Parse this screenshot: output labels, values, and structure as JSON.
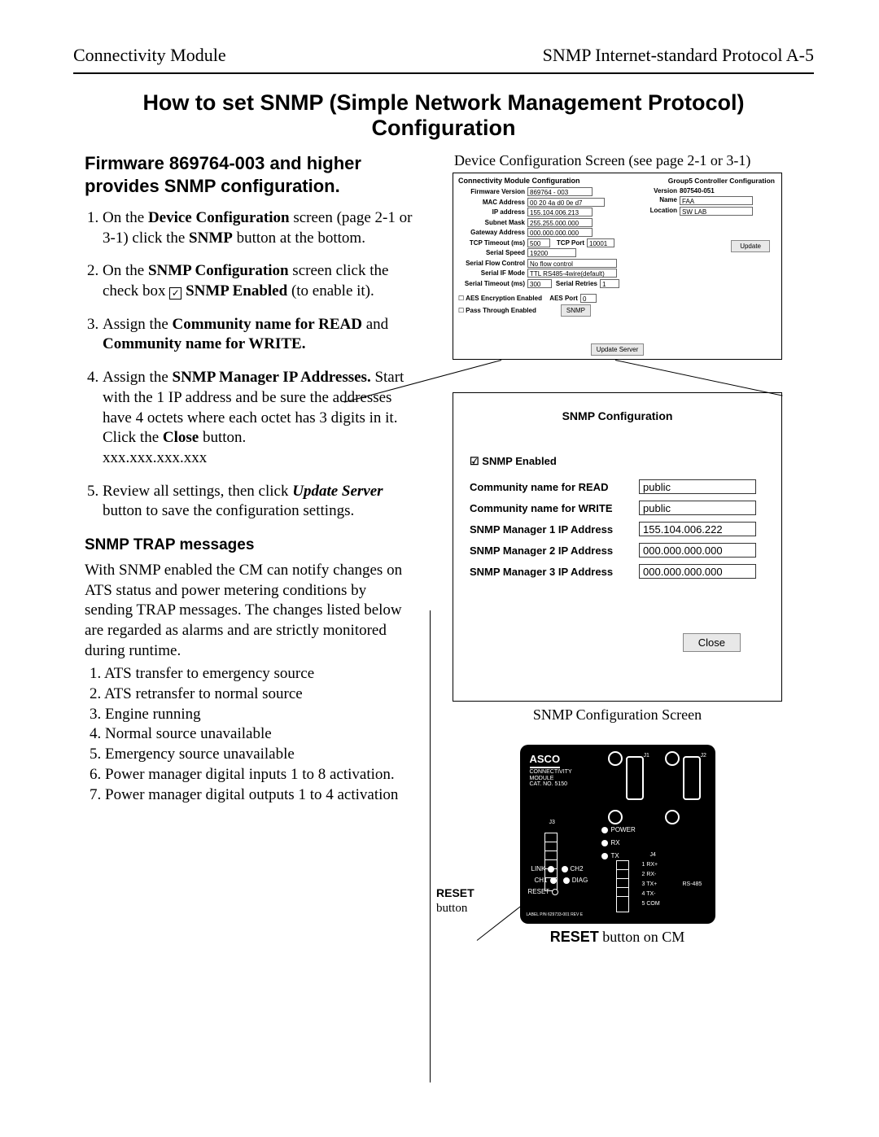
{
  "header": {
    "left": "Connectivity Module",
    "right": "SNMP Internet-standard Protocol    A-5"
  },
  "title": "How to set SNMP (Simple Network Management Protocol) Configuration",
  "subhead": "Firmware 869764-003 and higher provides SNMP configuration.",
  "steps": {
    "s1a": "On the ",
    "s1b": "Device Configuration",
    "s1c": " screen (page 2-1 or 3-1) click the ",
    "s1d": "SNMP",
    "s1e": " button at the bottom.",
    "s2a": "On the ",
    "s2b": "SNMP Configuration",
    "s2c": " screen click the check box  ",
    "s2chk": "☑",
    "s2d": " SNMP Enabled",
    "s2e": " (to enable it).",
    "s3a": "Assign the ",
    "s3b": "Community name for READ",
    "s3c": " and ",
    "s3d": "Community name for WRITE.",
    "s4a": "Assign the ",
    "s4b": "SNMP Manager IP Addresses.",
    "s4c": " Start with the 1 IP address and be sure the addresses have 4 octets where each octet has 3 digits in it.  Click the ",
    "s4d": "Close",
    "s4e": " button.",
    "s4f": "xxx.xxx.xxx.xxx",
    "s5a": "Review all settings, then click ",
    "s5b": "Update Server",
    "s5c": " button to save the configuration settings."
  },
  "trap_head": "SNMP TRAP messages",
  "trap_para": "With SNMP enabled the CM can notify changes on ATS status and power metering conditions by sending TRAP messages. The changes listed below are regarded as alarms and are strictly monitored during runtime.",
  "trap_items": {
    "t1": "1. ATS transfer to emergency source",
    "t2": "2. ATS retransfer to normal source",
    "t3": "3. Engine running",
    "t4": "4. Normal source unavailable",
    "t5": "5. Emergency source unavailable",
    "t6": "6. Power manager digital inputs 1 to 8 activation.",
    "t7": "7. Power manager digital outputs 1 to 4 activation"
  },
  "right_top_caption": "Device Configuration Screen (see page 2-1 or 3-1)",
  "devcfg": {
    "title": "Connectivity Module Configuration",
    "rows": {
      "fw_l": "Firmware Version",
      "fw_v": "869764 - 003",
      "mac_l": "MAC Address",
      "mac_v": "00 20 4a d0 0e d7",
      "ip_l": "IP address",
      "ip_v": "155.104.006.213",
      "sm_l": "Subnet Mask",
      "sm_v": "255.255.000.000",
      "gw_l": "Gateway Address",
      "gw_v": "000.000.000.000",
      "tcp_l": "TCP Timeout (ms)",
      "tcp_v": "500",
      "tport_l": "TCP Port",
      "tport_v": "10001",
      "ss_l": "Serial Speed",
      "ss_v": "19200",
      "sfc_l": "Serial Flow Control",
      "sfc_v": "No flow control",
      "sif_l": "Serial IF Mode",
      "sif_v": "TTL RS485-4wire(default)",
      "sto_l": "Serial Timeout (ms)",
      "sto_v": "300",
      "sr_l": "Serial Retries",
      "sr_v": "1",
      "aes_l": "AES Encryption Enabled",
      "aesp_l": "AES Port",
      "aesp_v": "0",
      "pt_l": "Pass Through Enabled",
      "snmp_btn": "SNMP",
      "upd_srv": "Update Server"
    },
    "g5": {
      "title": "Group5 Controller Configuration",
      "ver_l": "Version",
      "ver_v": "807540-051",
      "name_l": "Name",
      "name_v": "FAA",
      "loc_l": "Location",
      "loc_v": "SW LAB",
      "update": "Update"
    }
  },
  "snmp": {
    "title": "SNMP Configuration",
    "enabled_label": "SNMP Enabled",
    "read_l": "Community name for READ",
    "read_v": "public",
    "write_l": "Community name for WRITE",
    "write_v": "public",
    "m1_l": "SNMP Manager 1 IP Address",
    "m1_v": "155.104.006.222",
    "m2_l": "SNMP Manager 2 IP Address",
    "m2_v": "000.000.000.000",
    "m3_l": "SNMP Manager 3 IP Address",
    "m3_v": "000.000.000.000",
    "close": "Close"
  },
  "snmp_caption": "SNMP Configuration Screen",
  "hw": {
    "logo": "ASCO",
    "sub1": "CONNECTIVITY",
    "sub2": "MODULE",
    "sub3": "CAT. NO. 5150",
    "j1": "J1",
    "j2": "J2",
    "j3": "J3",
    "j4": "J4",
    "power": "POWER",
    "rx": "RX",
    "tx": "TX",
    "link": "LINK",
    "ch1": "CH1",
    "ch2": "CH2",
    "diag": "DIAG",
    "reset": "RESET",
    "t1": "1 RX+",
    "t2": "2 RX-",
    "t3": "3 TX+",
    "t4": "4 TX-",
    "t5": "5 COM",
    "rs": "RS-485",
    "pn": "LABEL P/N 629733-001 REV E"
  },
  "reset_label_b": "RESET",
  "reset_label_t": "button",
  "hw_caption_b": "RESET",
  "hw_caption_t": " button on CM"
}
